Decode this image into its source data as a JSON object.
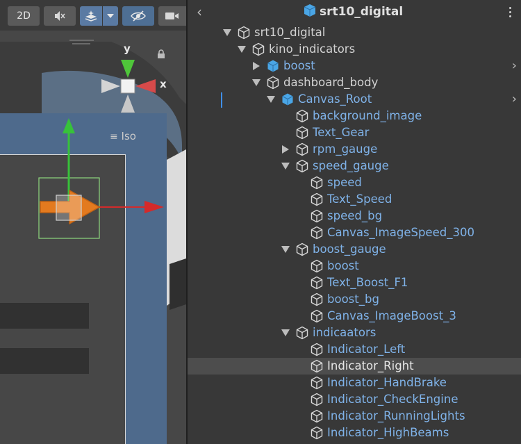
{
  "scene": {
    "toolbar": {
      "mode_label": "2D",
      "audio_icon": "audio-mute-icon",
      "effects_icon": "effects-icon",
      "visibility_icon": "hidden-eye-icon",
      "camera_icon": "camera-icon"
    },
    "gizmo": {
      "y_label": "y",
      "x_label": "x"
    },
    "iso_label": "Iso",
    "colors": {
      "canvas": "#4e6a8c",
      "handle": "#e37a1f",
      "y_axis": "#37c23a",
      "x_axis": "#d42a2a"
    }
  },
  "hierarchy": {
    "title": "srt10_digital",
    "rows": [
      {
        "label": "srt10_digital",
        "indent": 0,
        "arrow": "down",
        "prefab": false,
        "color": "white"
      },
      {
        "label": "kino_indicators",
        "indent": 1,
        "arrow": "down",
        "prefab": false,
        "color": "white"
      },
      {
        "label": "boost",
        "indent": 2,
        "arrow": "right",
        "prefab": true,
        "color": "blue",
        "chevron": true
      },
      {
        "label": "dashboard_body",
        "indent": 2,
        "arrow": "down",
        "prefab": false,
        "color": "white"
      },
      {
        "label": "Canvas_Root",
        "indent": 3,
        "arrow": "down",
        "prefab": true,
        "color": "blue",
        "chevron": true
      },
      {
        "label": "background_image",
        "indent": 4,
        "arrow": "none",
        "prefab": false,
        "color": "blue"
      },
      {
        "label": "Text_Gear",
        "indent": 4,
        "arrow": "none",
        "prefab": false,
        "color": "blue"
      },
      {
        "label": "rpm_gauge",
        "indent": 4,
        "arrow": "right",
        "prefab": false,
        "color": "blue"
      },
      {
        "label": "speed_gauge",
        "indent": 4,
        "arrow": "down",
        "prefab": false,
        "color": "blue"
      },
      {
        "label": "speed",
        "indent": 5,
        "arrow": "none",
        "prefab": false,
        "color": "blue"
      },
      {
        "label": "Text_Speed",
        "indent": 5,
        "arrow": "none",
        "prefab": false,
        "color": "blue"
      },
      {
        "label": "speed_bg",
        "indent": 5,
        "arrow": "none",
        "prefab": false,
        "color": "blue"
      },
      {
        "label": "Canvas_ImageSpeed_300",
        "indent": 5,
        "arrow": "none",
        "prefab": false,
        "color": "blue"
      },
      {
        "label": "boost_gauge",
        "indent": 4,
        "arrow": "down",
        "prefab": false,
        "color": "blue"
      },
      {
        "label": "boost",
        "indent": 5,
        "arrow": "none",
        "prefab": false,
        "color": "blue"
      },
      {
        "label": "Text_Boost_F1",
        "indent": 5,
        "arrow": "none",
        "prefab": false,
        "color": "blue"
      },
      {
        "label": "boost_bg",
        "indent": 5,
        "arrow": "none",
        "prefab": false,
        "color": "blue"
      },
      {
        "label": "Canvas_ImageBoost_3",
        "indent": 5,
        "arrow": "none",
        "prefab": false,
        "color": "blue"
      },
      {
        "label": "indicaators",
        "indent": 4,
        "arrow": "down",
        "prefab": false,
        "color": "blue"
      },
      {
        "label": "Indicator_Left",
        "indent": 5,
        "arrow": "none",
        "prefab": false,
        "color": "blue"
      },
      {
        "label": "Indicator_Right",
        "indent": 5,
        "arrow": "none",
        "prefab": false,
        "color": "selected",
        "selected": true
      },
      {
        "label": "Indicator_HandBrake",
        "indent": 5,
        "arrow": "none",
        "prefab": false,
        "color": "blue"
      },
      {
        "label": "Indicator_CheckEngine",
        "indent": 5,
        "arrow": "none",
        "prefab": false,
        "color": "blue"
      },
      {
        "label": "Indicator_RunningLights",
        "indent": 5,
        "arrow": "none",
        "prefab": false,
        "color": "blue"
      },
      {
        "label": "Indicator_HighBeams",
        "indent": 5,
        "arrow": "none",
        "prefab": false,
        "color": "blue"
      }
    ]
  }
}
